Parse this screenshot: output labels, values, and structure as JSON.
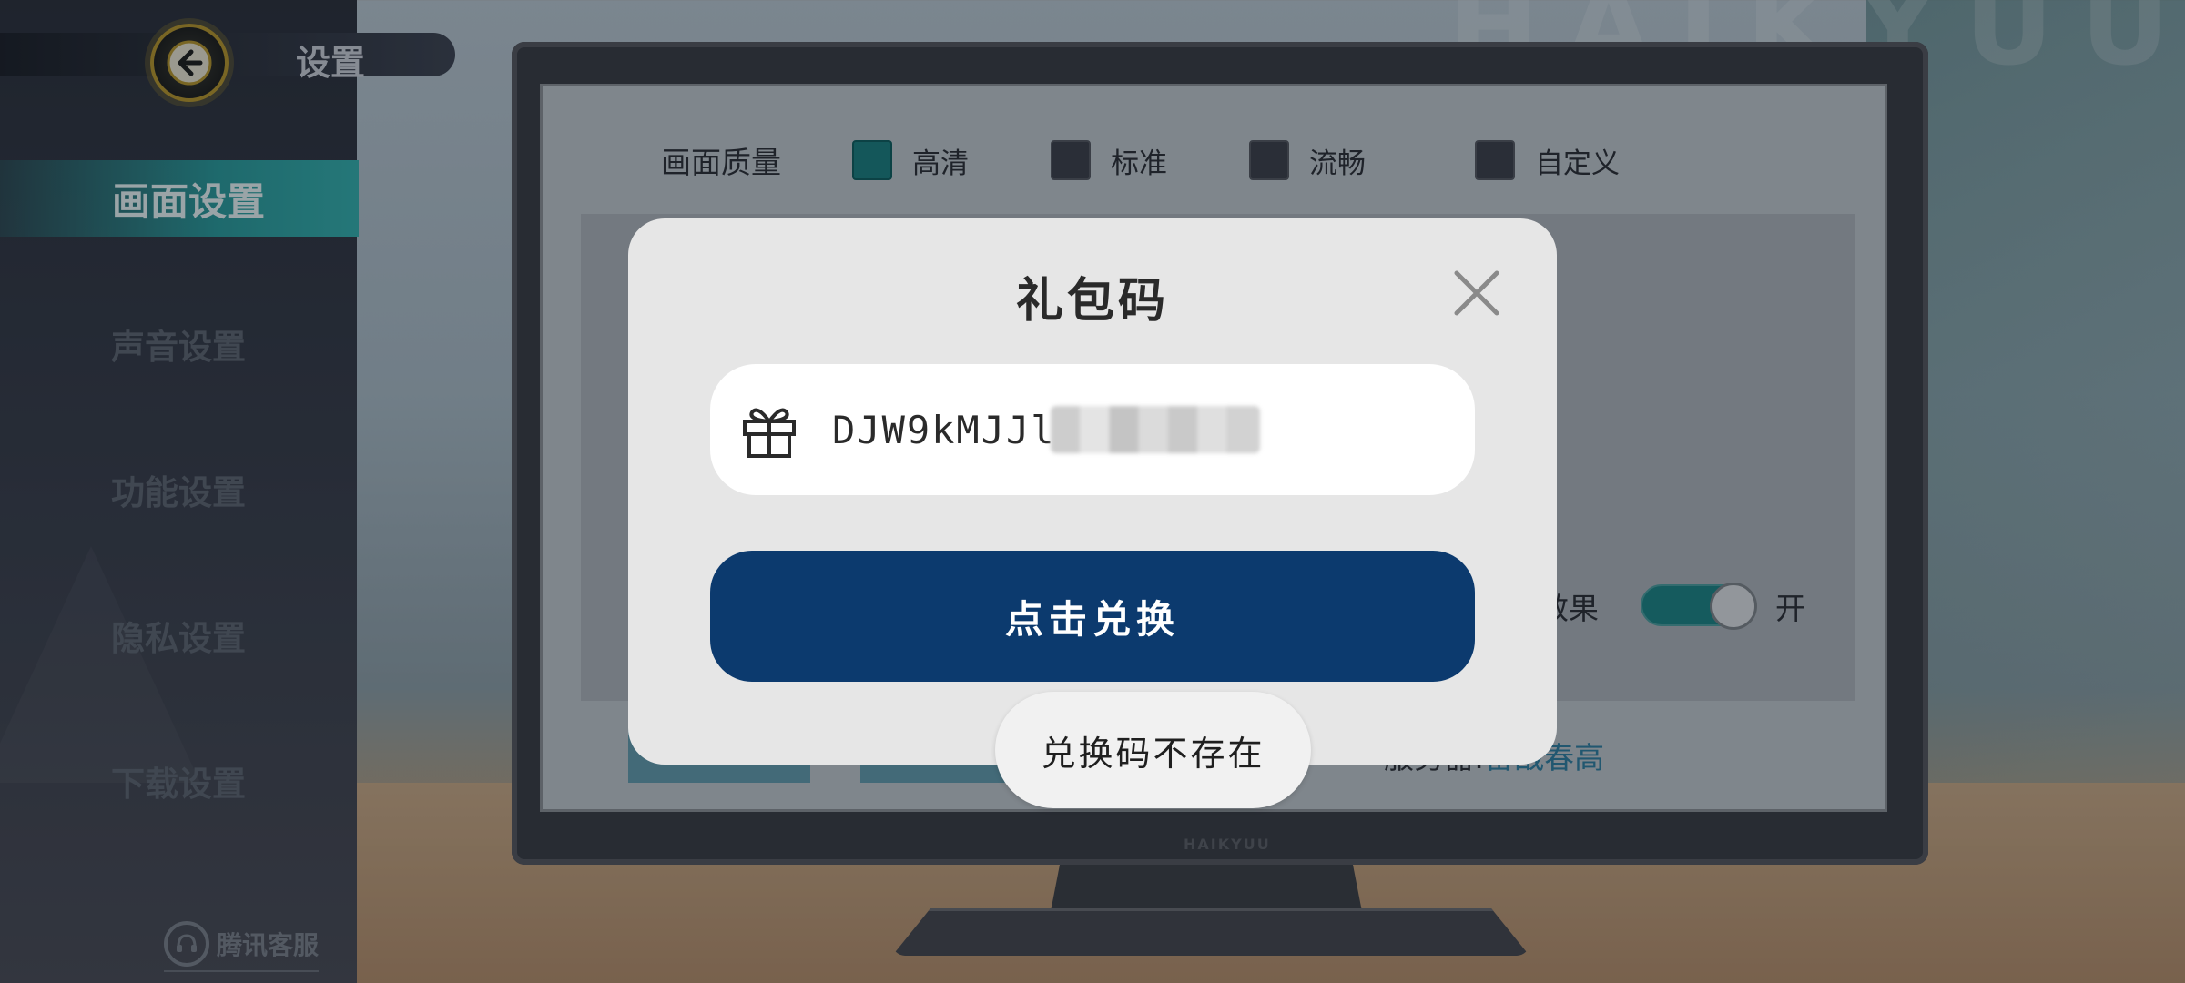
{
  "header": {
    "title": "设置",
    "back_icon": "back-arrow-icon"
  },
  "sidebar": {
    "items": [
      {
        "label": "画面设置",
        "active": true
      },
      {
        "label": "声音设置",
        "active": false
      },
      {
        "label": "功能设置",
        "active": false
      },
      {
        "label": "隐私设置",
        "active": false
      },
      {
        "label": "下载设置",
        "active": false
      }
    ],
    "customer_service": "腾讯客服"
  },
  "settings": {
    "quality_label": "画面质量",
    "quality_options": [
      {
        "label": "高清",
        "checked": true
      },
      {
        "label": "标准",
        "checked": false
      },
      {
        "label": "流畅",
        "checked": false
      },
      {
        "label": "自定义",
        "checked": false
      }
    ],
    "effect_label_partial": "效果",
    "effect_toggle_state": "开",
    "server_label": "服务器:",
    "server_value": "备战春高",
    "monitor_brand": "HAIKYUU"
  },
  "dialog": {
    "title": "礼包码",
    "code_value": "DJW9kMJJl",
    "redeem_label": "点击兑换",
    "gift_icon": "gift-icon",
    "close_icon": "close-icon"
  },
  "toast": {
    "message": "兑换码不存在"
  },
  "colors": {
    "accent_teal": "#1b7f7f",
    "redeem_button": "#0c3a6e",
    "dialog_bg": "#e6e6e6",
    "server_value": "#2f7fa0"
  }
}
